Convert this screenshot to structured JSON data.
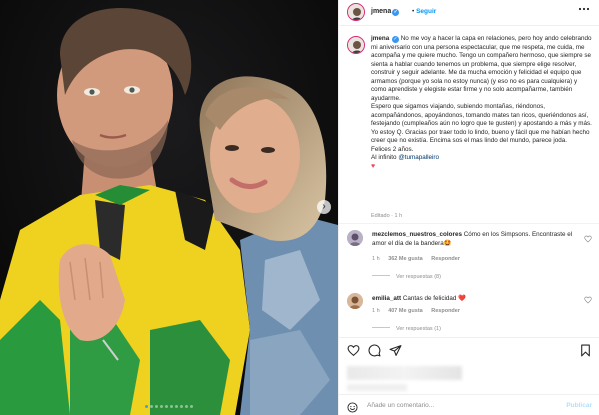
{
  "post": {
    "username": "jmena",
    "verified_mark": "✓",
    "follow_separator": "•",
    "follow_label": "Seguir",
    "more_icon": "more-horizontal-icon"
  },
  "caption": {
    "username": "jmena",
    "paragraphs": [
      "No me voy a hacer la capa en relaciones, pero hoy ando celebrando mi aniversario con una persona espectacular, que me respeta, me cuida, me acompaña y me quiere mucho. Tengo un compañero hermoso, que siempre se sienta a hablar cuando tenemos un problema, que siempre elige resolver, construir y seguir adelante. Me da mucha emoción y felicidad el equipo que armamos (porque yo sola no estoy nunca) (y eso no es para cualquiera) y como aprendiste y elegiste estar firme y no solo acompañarme, también ayudarme.",
      "Espero que sigamos viajando, subiendo montañas, riéndonos, acompañándonos, apoyándonos, tomando mates tan ricos, queriéndonos así, festejando (cumpleaños aún no logro que te gusten) y apostando a más y más. Yo estoy Q. Gracias por traer todo lo lindo, bueno y fácil que me habían hecho creer que no existía. Encima sos el mas lindo del mundo, parece joda.",
      "Felices 2 años."
    ],
    "mention_prefix": "Al infinito",
    "mention": "@tumapalleiro",
    "heart": "♥",
    "edited": "Editado · 1 h"
  },
  "comments": [
    {
      "username": "mezclemos_nuestros_colores",
      "text": "Cómo en los Simpsons. Encontraste el amor el día de la bandera🤩",
      "time": "1 h",
      "likes": "362 Me gusta",
      "reply": "Responder",
      "view_replies": "Ver respuestas (8)"
    },
    {
      "username": "emilia_att",
      "text": "Cantas de felicidad ❤️",
      "time": "1 h",
      "likes": "407 Me gusta",
      "reply": "Responder",
      "view_replies": "Ver respuestas (1)"
    }
  ],
  "actions": {
    "like_icon": "heart-icon",
    "comment_icon": "comment-icon",
    "share_icon": "share-icon",
    "save_icon": "bookmark-icon"
  },
  "add_comment": {
    "placeholder": "Añade un comentario...",
    "post_label": "Publicar"
  },
  "colors": {
    "link_blue": "#0095f6",
    "mention_blue": "#00376b",
    "heart_red": "#ed4956",
    "muted": "#8e8e8e"
  },
  "carousel": {
    "slide_count": 10,
    "active_index": 0
  }
}
